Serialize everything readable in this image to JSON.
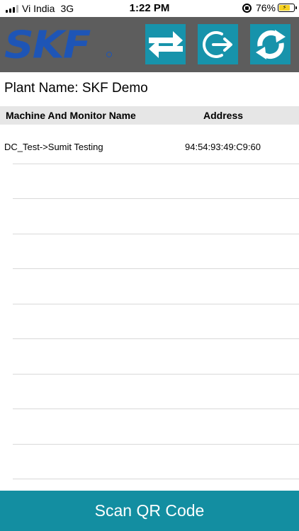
{
  "status_bar": {
    "carrier": "Vi India",
    "network": "3G",
    "time": "1:22 PM",
    "battery": "76%"
  },
  "header": {
    "logo_text": "SKF",
    "buttons": [
      {
        "name": "transfer",
        "icon": "transfer-arrows-icon"
      },
      {
        "name": "logout",
        "icon": "logout-icon"
      },
      {
        "name": "refresh",
        "icon": "refresh-icon"
      }
    ],
    "colors": {
      "header_bg": "#5d5d5d",
      "button_bg": "#1793ab",
      "logo": "#1e55b6"
    }
  },
  "plant": {
    "label": "Plant Name: SKF Demo"
  },
  "table": {
    "headers": {
      "name": "Machine And Monitor Name",
      "address": "Address"
    },
    "rows": [
      {
        "name": "DC_Test->Sumit Testing",
        "address": "94:54:93:49:C9:60"
      },
      {
        "name": "",
        "address": ""
      },
      {
        "name": "",
        "address": ""
      },
      {
        "name": "",
        "address": ""
      },
      {
        "name": "",
        "address": ""
      },
      {
        "name": "",
        "address": ""
      },
      {
        "name": "",
        "address": ""
      },
      {
        "name": "",
        "address": ""
      },
      {
        "name": "",
        "address": ""
      },
      {
        "name": "",
        "address": ""
      }
    ]
  },
  "footer": {
    "scan_label": "Scan QR Code",
    "color": "#138ea1"
  }
}
